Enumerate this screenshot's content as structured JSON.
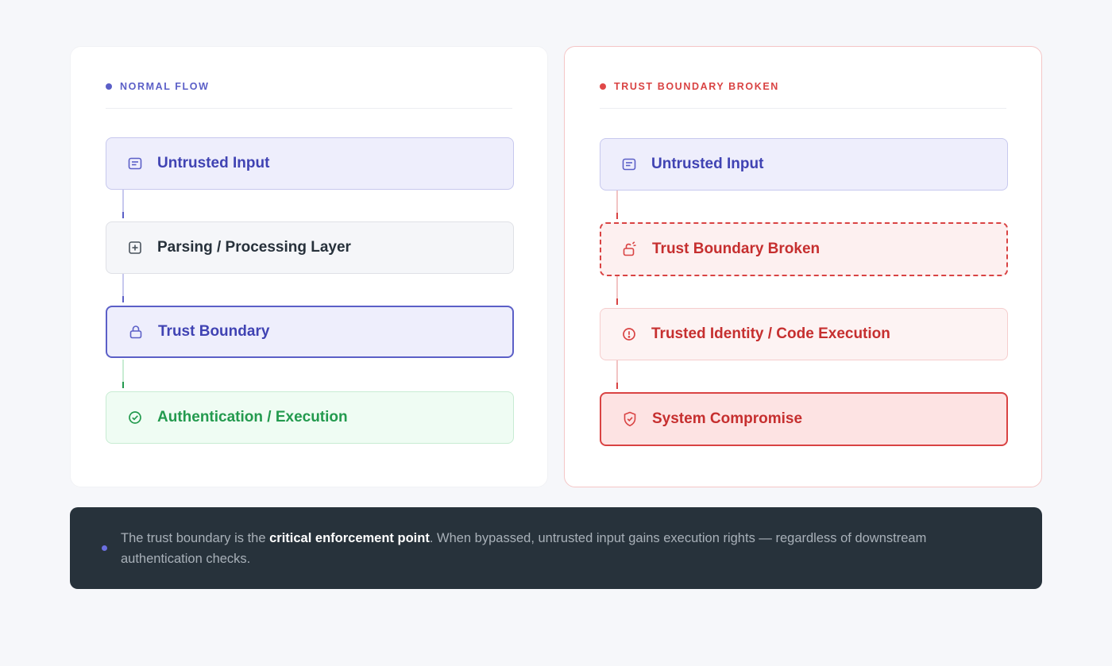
{
  "left_panel": {
    "title": "NORMAL FLOW",
    "nodes": [
      {
        "label": "Untrusted Input",
        "icon": "message-icon"
      },
      {
        "label": "Parsing / Processing Layer",
        "icon": "plus-square-icon"
      },
      {
        "label": "Trust Boundary",
        "icon": "lock-icon"
      },
      {
        "label": "Authentication / Execution",
        "icon": "check-circle-icon"
      }
    ]
  },
  "right_panel": {
    "title": "TRUST BOUNDARY BROKEN",
    "nodes": [
      {
        "label": "Untrusted Input",
        "icon": "message-icon"
      },
      {
        "label": "Trust Boundary Broken",
        "icon": "unlock-icon"
      },
      {
        "label": "Trusted Identity / Code Execution",
        "icon": "alert-circle-icon"
      },
      {
        "label": "System Compromise",
        "icon": "shield-check-icon"
      }
    ]
  },
  "note": {
    "prefix": "The trust boundary is the ",
    "emphasis": "critical enforcement point",
    "suffix": ". When bypassed, untrusted input gains execution rights — regardless of downstream authentication checks."
  },
  "colors": {
    "indigo": "#5b5fc7",
    "red": "#d94343",
    "green": "#239a4e",
    "dark": "#27323b"
  }
}
